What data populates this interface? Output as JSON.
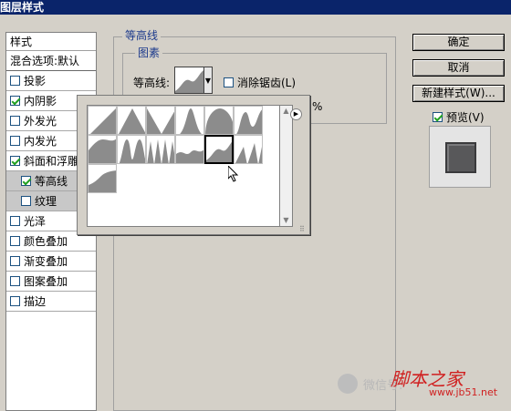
{
  "window": {
    "title": "图层样式"
  },
  "styles_panel": {
    "header": "样式",
    "blend_options": "混合选项:默认",
    "items": [
      {
        "label": "投影",
        "checked": false,
        "sub": false,
        "highlighted": false
      },
      {
        "label": "内阴影",
        "checked": true,
        "sub": false,
        "highlighted": false
      },
      {
        "label": "外发光",
        "checked": false,
        "sub": false,
        "highlighted": false
      },
      {
        "label": "内发光",
        "checked": false,
        "sub": false,
        "highlighted": false
      },
      {
        "label": "斜面和浮雕",
        "checked": true,
        "sub": false,
        "highlighted": false
      },
      {
        "label": "等高线",
        "checked": true,
        "sub": true,
        "highlighted": true
      },
      {
        "label": "纹理",
        "checked": false,
        "sub": true,
        "highlighted": true
      },
      {
        "label": "光泽",
        "checked": false,
        "sub": false,
        "highlighted": false
      },
      {
        "label": "颜色叠加",
        "checked": false,
        "sub": false,
        "highlighted": false
      },
      {
        "label": "渐变叠加",
        "checked": false,
        "sub": false,
        "highlighted": false
      },
      {
        "label": "图案叠加",
        "checked": false,
        "sub": false,
        "highlighted": false
      },
      {
        "label": "描边",
        "checked": false,
        "sub": false,
        "highlighted": false
      }
    ]
  },
  "contour_group": {
    "title": "等高线",
    "elements_title": "图素",
    "contour_label": "等高线:",
    "antialias_label": "消除锯齿(L)",
    "antialias_checked": false,
    "range_unit": "%"
  },
  "contour_picker": {
    "selected_index": 10,
    "presets": [
      "linear",
      "cone",
      "cone-inverted",
      "gaussian",
      "half-round",
      "ring",
      "cove-deep",
      "double-ring",
      "triple-ring",
      "rolling-slope",
      "rounded-steps",
      "sawtooth",
      "cove-shallow"
    ]
  },
  "buttons": {
    "ok": "确定",
    "cancel": "取消",
    "new_style": "新建样式(W)...",
    "preview_label": "预览(V)",
    "preview_checked": true
  },
  "icons": {
    "picker_menu": "right-arrow-circle-icon",
    "scroll_up": "scroll-up-icon",
    "scroll_down": "scroll-down-icon",
    "cursor": "arrow-cursor-icon",
    "watermark": "wechat-icon"
  },
  "watermark": {
    "wechat_text": "微信号:",
    "site_name": "脚本之家",
    "url": "www.jb51.net"
  },
  "colors": {
    "titlebar": "#0a246a",
    "contour_fill": "#8c8c8c",
    "check": "#21a121",
    "brand": "#d02020"
  }
}
